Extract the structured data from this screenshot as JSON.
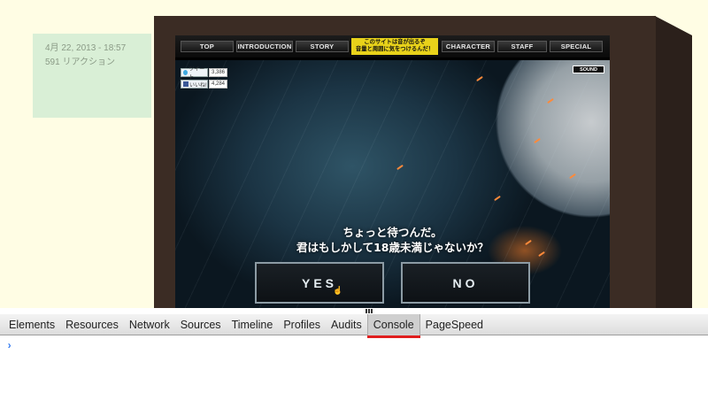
{
  "post": {
    "date": "4月 22, 2013 - 18:57",
    "reactions": "591 リアクション"
  },
  "site": {
    "nav": [
      {
        "label": "TOP"
      },
      {
        "label": "INTRODUCTION"
      },
      {
        "label": "STORY"
      },
      {
        "label": "CHARACTER"
      },
      {
        "label": "STAFF"
      },
      {
        "label": "SPECIAL"
      }
    ],
    "notice_line1": "このサイトは音が出るぞ",
    "notice_line2": "音量と周囲に気をつけるんだ！",
    "tweet_label": "ツイート",
    "tweet_count": "3,386",
    "like_label": "いいね!",
    "like_count": "4,284",
    "sound_label": "SOUND",
    "question_line1": "ちょっと待つんだ。",
    "question_line2": "君はもしかして18歳未満じゃないか？",
    "yes_label": "YES",
    "no_label": "NO"
  },
  "devtools": {
    "tabs": [
      "Elements",
      "Resources",
      "Network",
      "Sources",
      "Timeline",
      "Profiles",
      "Audits",
      "Console",
      "PageSpeed"
    ],
    "active_tab": "Console",
    "prompt_symbol": "›"
  },
  "colors": {
    "post_meta_bg": "#d9efd6",
    "notice_bg": "#e8d21a",
    "active_tab_underline": "#e01e1e",
    "console_prompt": "#367cf1"
  }
}
